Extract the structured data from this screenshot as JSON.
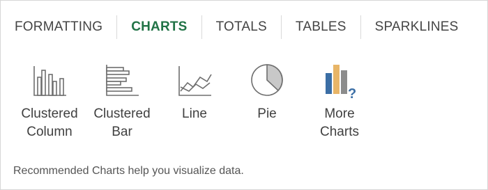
{
  "tabs": [
    {
      "label": "FORMATTING",
      "active": false
    },
    {
      "label": "CHARTS",
      "active": true
    },
    {
      "label": "TOTALS",
      "active": false
    },
    {
      "label": "TABLES",
      "active": false
    },
    {
      "label": "SPARKLINES",
      "active": false
    }
  ],
  "options": [
    {
      "label_line1": "Clustered",
      "label_line2": "Column",
      "icon": "clustered-column-chart-icon"
    },
    {
      "label_line1": "Clustered",
      "label_line2": "Bar",
      "icon": "clustered-bar-chart-icon"
    },
    {
      "label_line1": "Line",
      "label_line2": "",
      "icon": "line-chart-icon"
    },
    {
      "label_line1": "Pie",
      "label_line2": "",
      "icon": "pie-chart-icon"
    },
    {
      "label_line1": "More",
      "label_line2": "Charts",
      "icon": "more-charts-icon"
    }
  ],
  "description": "Recommended Charts help you visualize data.",
  "colors": {
    "active_tab": "#217346",
    "text": "#444444",
    "icon_stroke": "#6e6e6e",
    "more_blue": "#3b6ea5",
    "more_orange": "#e8b567",
    "more_gray": "#8c8c8c"
  }
}
